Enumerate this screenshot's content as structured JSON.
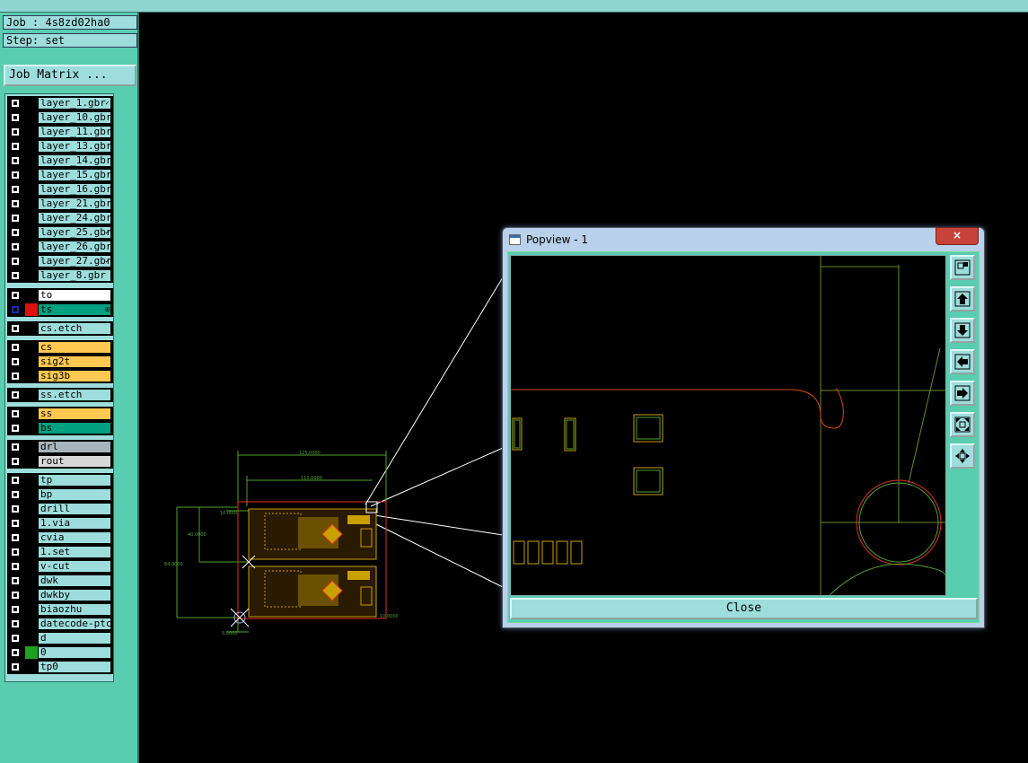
{
  "header": {
    "job_line": "Job : 4s8zd02ha0",
    "step_line": "Step: set",
    "job_matrix_label": "Job Matrix ..."
  },
  "layers": {
    "group1": [
      "layer_1.gbr",
      "layer_10.gbr",
      "layer_11.gbr",
      "layer_13.gbr",
      "layer_14.gbr",
      "layer_15.gbr",
      "layer_16.gbr",
      "layer_21.gbr",
      "layer_24.gbr",
      "layer_25.gbr",
      "layer_26.gbr",
      "layer_27.gbr",
      "layer_8.gbr"
    ],
    "group2": [
      "to",
      "ts"
    ],
    "group3": [
      "cs.etch"
    ],
    "group4": [
      "cs",
      "sig2t",
      "sig3b"
    ],
    "group5": [
      "ss.etch"
    ],
    "group6": [
      "ss",
      "bs"
    ],
    "group7": [
      "drl",
      "rout"
    ],
    "group8": [
      "tp",
      "bp",
      "drill",
      "1.via",
      "cvia",
      "1.set",
      "v-cut",
      "dwk",
      "dwkby",
      "biaozhu",
      "datecode-ptc",
      "d",
      "0",
      "tp0"
    ]
  },
  "board": {
    "dim_top": "125.0000",
    "dim_top2": "110.0000",
    "dim_left": "84.0000",
    "dim_left2": "40.0000",
    "dim_small_left": "10.0000",
    "dim_bottom": "5.0000",
    "dim_bottom_right": "10.0000"
  },
  "popup": {
    "title": "Popview - 1",
    "close_x": "×",
    "close_label": "Close"
  },
  "colors": {
    "panel": "#58cdb0",
    "field": "#9ddedd",
    "board_yellow": "#c8a000",
    "outline_green": "#50a030",
    "route_red": "#e03020"
  }
}
